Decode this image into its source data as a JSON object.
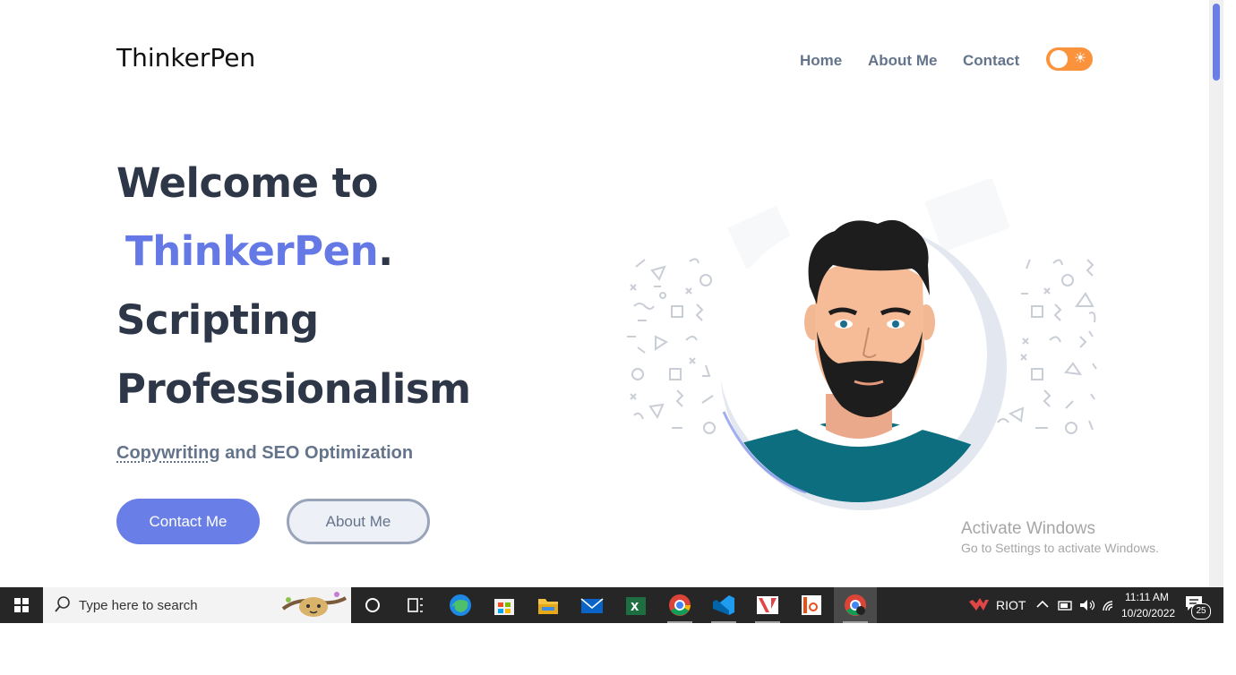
{
  "header": {
    "logo": "ThinkerPen",
    "nav": [
      {
        "label": "Home"
      },
      {
        "label": "About Me"
      },
      {
        "label": "Contact"
      }
    ]
  },
  "hero": {
    "line1": "Welcome to",
    "brand": "ThinkerPen",
    "dot": ".",
    "line3": "Scripting",
    "line4": "Professionalism",
    "subtitle_underlined": "Copywriting",
    "subtitle_rest": " and SEO Optimization",
    "contact_button": "Contact Me",
    "about_button": "About Me"
  },
  "watermark": {
    "title": "Activate Windows",
    "subtitle": "Go to Settings to activate Windows."
  },
  "taskbar": {
    "search_placeholder": "Type here to search",
    "riot_label": "RIOT",
    "time": "11:11 AM",
    "date": "10/20/2022",
    "notification_count": "25"
  },
  "colors": {
    "accent": "#6a7ee8",
    "brand": "#6478e6",
    "heading": "#2d3748",
    "muted": "#64748b",
    "toggle": "#fb923c"
  },
  "icons": [
    "sun-icon",
    "windows-start-icon",
    "search-icon",
    "cortana-icon",
    "task-view-icon",
    "edge-icon",
    "store-icon",
    "file-explorer-icon",
    "mail-icon",
    "excel-icon",
    "chrome-icon",
    "vscode-icon",
    "riot-icon",
    "office-icon",
    "notification-icon"
  ]
}
